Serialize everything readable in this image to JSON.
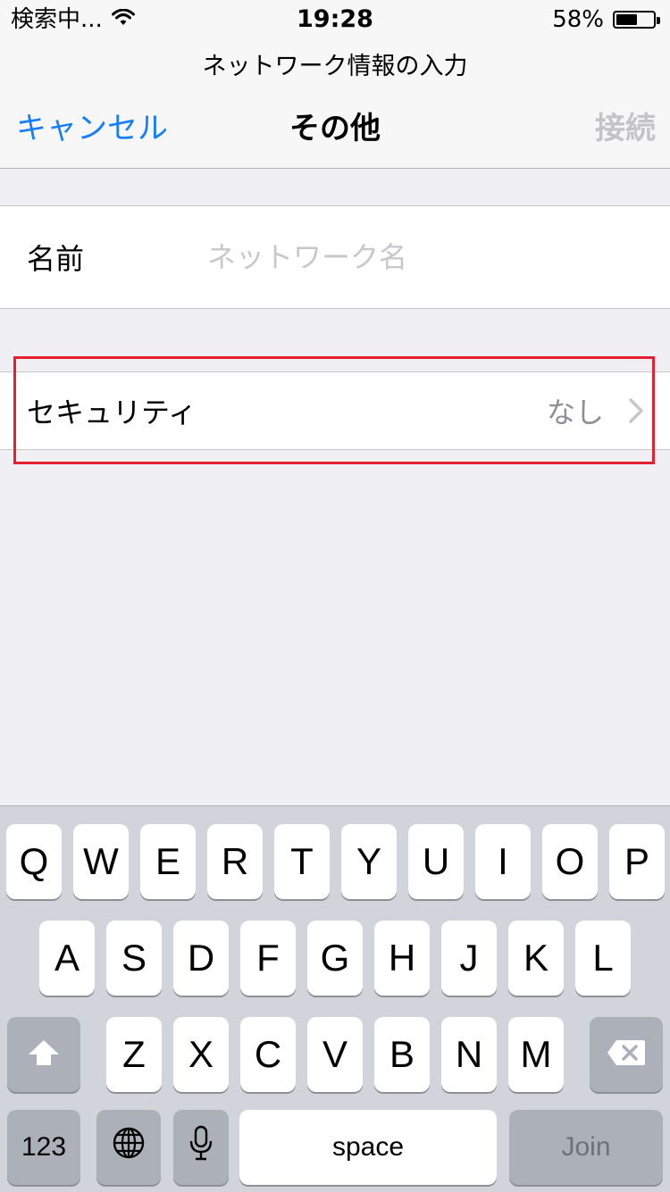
{
  "status_bar": {
    "carrier": "検索中...",
    "time": "19:28",
    "battery_percent_label": "58%",
    "battery_level": 0.58
  },
  "nav": {
    "prompt": "ネットワーク情報の入力",
    "cancel_label": "キャンセル",
    "title": "その他",
    "join_label": "接続"
  },
  "form": {
    "name_label": "名前",
    "name_value": "",
    "name_placeholder": "ネットワーク名",
    "security_label": "セキュリティ",
    "security_value": "なし"
  },
  "keyboard": {
    "row1": [
      "Q",
      "W",
      "E",
      "R",
      "T",
      "Y",
      "U",
      "I",
      "O",
      "P"
    ],
    "row2": [
      "A",
      "S",
      "D",
      "F",
      "G",
      "H",
      "J",
      "K",
      "L"
    ],
    "row3": [
      "Z",
      "X",
      "C",
      "V",
      "B",
      "N",
      "M"
    ],
    "numbers_label": "123",
    "space_label": "space",
    "join_label": "Join"
  },
  "colors": {
    "accent": "#147efb",
    "disabled": "#c3c3c8",
    "highlight": "#e5212f",
    "background": "#efeff4"
  }
}
